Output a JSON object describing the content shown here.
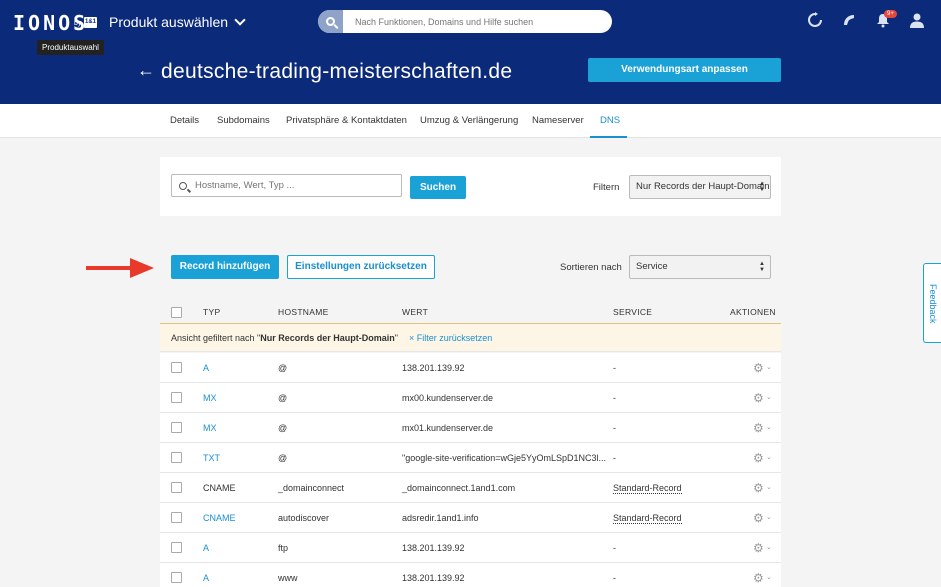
{
  "header": {
    "logo": "IONOS",
    "logo_by": "by",
    "logo_11": "1&1",
    "product_select": "Produkt auswählen",
    "tooltip": "Produktauswahl",
    "search_placeholder": "Nach Funktionen, Domains und Hilfe suchen",
    "notification_badge": "9+",
    "domain": "deutsche-trading-meisterschaften.de",
    "usage_button": "Verwendungsart anpassen"
  },
  "tabs": [
    {
      "label": "Details"
    },
    {
      "label": "Subdomains"
    },
    {
      "label": "Privatsphäre & Kontaktdaten"
    },
    {
      "label": "Umzug & Verlängerung"
    },
    {
      "label": "Nameserver"
    },
    {
      "label": "DNS",
      "active": true
    }
  ],
  "filter": {
    "input_placeholder": "Hostname, Wert, Typ ...",
    "search_button": "Suchen",
    "filter_label": "Filtern",
    "filter_value": "Nur Records der Haupt-Domain"
  },
  "actions": {
    "add_record": "Record hinzufügen",
    "reset_settings": "Einstellungen zurücksetzen",
    "sort_label": "Sortieren nach",
    "sort_value": "Service"
  },
  "table": {
    "headers": {
      "type": "TYP",
      "hostname": "HOSTNAME",
      "value": "WERT",
      "service": "SERVICE",
      "actions": "AKTIONEN"
    },
    "notice_prefix": "Ansicht gefiltert nach \"",
    "notice_bold": "Nur Records der Haupt-Domain",
    "notice_suffix": "\"",
    "notice_reset": "× Filter zurücksetzen",
    "rows": [
      {
        "type": "A",
        "type_link": true,
        "hostname": "@",
        "value": "138.201.139.92",
        "service": "-"
      },
      {
        "type": "MX",
        "type_link": true,
        "hostname": "@",
        "value": "mx00.kundenserver.de",
        "service": "-"
      },
      {
        "type": "MX",
        "type_link": true,
        "hostname": "@",
        "value": "mx01.kundenserver.de",
        "service": "-"
      },
      {
        "type": "TXT",
        "type_link": true,
        "hostname": "@",
        "value": "\"google-site-verification=wGje5YyOmLSpD1NC3l...",
        "service": "-"
      },
      {
        "type": "CNAME",
        "type_link": false,
        "hostname": "_domainconnect",
        "value": "_domainconnect.1and1.com",
        "service": "Standard-Record"
      },
      {
        "type": "CNAME",
        "type_link": true,
        "hostname": "autodiscover",
        "value": "adsredir.1and1.info",
        "service": "Standard-Record"
      },
      {
        "type": "A",
        "type_link": true,
        "hostname": "ftp",
        "value": "138.201.139.92",
        "service": "-"
      },
      {
        "type": "A",
        "type_link": true,
        "hostname": "www",
        "value": "138.201.139.92",
        "service": "-"
      }
    ]
  },
  "feedback": "Feedback",
  "colors": {
    "header_bg": "#0b2a7a",
    "accent": "#1aa1d6",
    "link": "#1a8fd0",
    "arrow": "#e8392b"
  }
}
